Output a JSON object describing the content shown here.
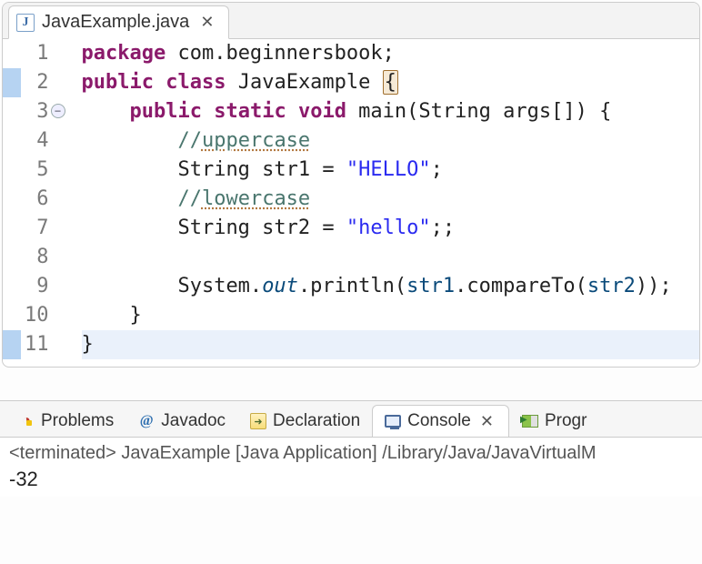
{
  "editor": {
    "tab": {
      "filename": "JavaExample.java"
    },
    "lines": [
      {
        "n": "1",
        "fold": "",
        "marker": "",
        "html": "<span class='kw'>package</span> com.beginnersbook;"
      },
      {
        "n": "2",
        "fold": "",
        "marker": "blue",
        "html": "<span class='kw'>public</span> <span class='kw'>class</span> JavaExample <span class='brmatch'>{</span>"
      },
      {
        "n": "3",
        "fold": "⊖",
        "marker": "",
        "html": "    <span class='kw'>public</span> <span class='kw'>static</span> <span class='typ'>void</span> main(String args[]) {"
      },
      {
        "n": "4",
        "fold": "",
        "marker": "",
        "html": "        <span class='cm'>//<span class='underdot'>uppercase</span></span>"
      },
      {
        "n": "5",
        "fold": "",
        "marker": "",
        "html": "        String str1 = <span class='str'>\"HELLO\"</span>;"
      },
      {
        "n": "6",
        "fold": "",
        "marker": "",
        "html": "        <span class='cm'>//<span class='underdot'>lowercase</span></span>"
      },
      {
        "n": "7",
        "fold": "",
        "marker": "",
        "html": "        String str2 = <span class='str'>\"hello\"</span>;;"
      },
      {
        "n": "8",
        "fold": "",
        "marker": "",
        "html": ""
      },
      {
        "n": "9",
        "fold": "",
        "marker": "",
        "html": "        System.<span class='ident italic'>out</span>.println(<span class='ident'>str1</span>.compareTo(<span class='ident'>str2</span>));"
      },
      {
        "n": "10",
        "fold": "",
        "marker": "",
        "html": "    }"
      },
      {
        "n": "11",
        "fold": "",
        "marker": "blue",
        "html": "}",
        "hl": true
      }
    ]
  },
  "bottomTabs": {
    "problems": "Problems",
    "javadoc": "Javadoc",
    "declaration": "Declaration",
    "console": "Console",
    "progress": "Progr"
  },
  "console": {
    "status": "<terminated> JavaExample [Java Application] /Library/Java/JavaVirtualM",
    "output": "-32"
  }
}
